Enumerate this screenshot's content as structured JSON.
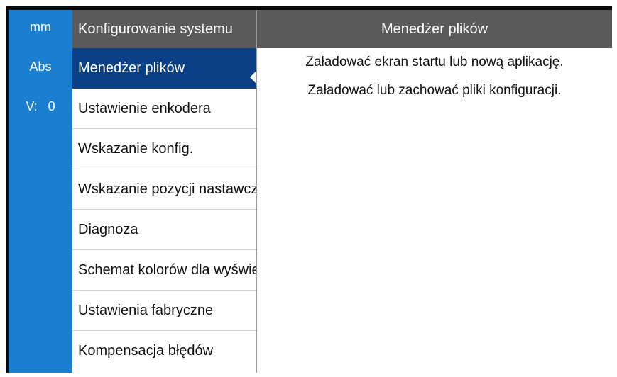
{
  "status": {
    "unit": "mm",
    "mode": "Abs",
    "v_label": "V:",
    "v_value": "0"
  },
  "menu": {
    "title": "Konfigurowanie systemu",
    "items": [
      {
        "label": "Menedżer plików"
      },
      {
        "label": "Ustawienie enkodera"
      },
      {
        "label": "Wskazanie konfig."
      },
      {
        "label": "Wskazanie pozycji nastawczej"
      },
      {
        "label": "Diagnoza"
      },
      {
        "label": "Schemat kolorów dla wyświetlacza"
      },
      {
        "label": "Ustawienia fabryczne"
      },
      {
        "label": "Kompensacja błędów"
      }
    ]
  },
  "panel": {
    "title": "Menedżer plików",
    "line1": "Załadować ekran startu lub nową aplikację.",
    "line2": "Załadować lub zachować pliki konfiguracji."
  },
  "colors": {
    "status_bar": "#1a7fd0",
    "header": "#5a5a5a",
    "selected": "#0b3f86"
  }
}
